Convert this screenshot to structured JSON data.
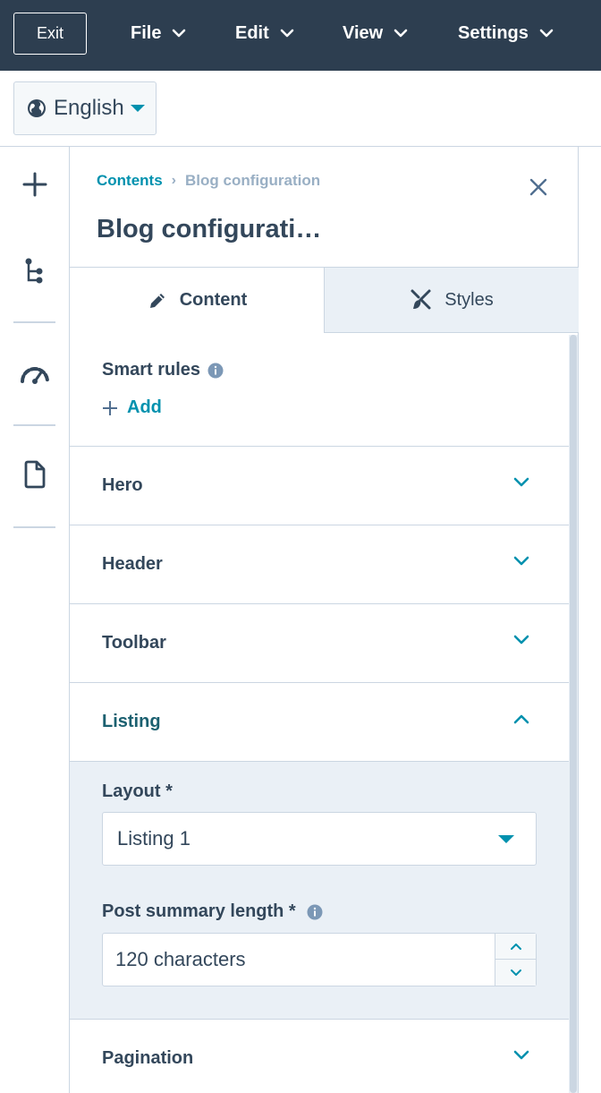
{
  "topbar": {
    "exit_label": "Exit",
    "menus": [
      {
        "label": "File"
      },
      {
        "label": "Edit"
      },
      {
        "label": "View"
      },
      {
        "label": "Settings"
      }
    ]
  },
  "language": {
    "selected": "English",
    "icon": "globe-icon"
  },
  "rail": {
    "icons": [
      "plus-icon",
      "tree-icon",
      "gauge-icon",
      "page-icon"
    ]
  },
  "panel": {
    "breadcrumb": {
      "parent": "Contents",
      "separator": "›",
      "current": "Blog configuration"
    },
    "title": "Blog configurati…",
    "tabs": [
      {
        "label": "Content",
        "icon": "pencil-icon",
        "active": true
      },
      {
        "label": "Styles",
        "icon": "brush-icon",
        "active": false
      }
    ],
    "smart_rules": {
      "label": "Smart rules",
      "add_label": "Add"
    },
    "sections": [
      {
        "label": "Hero",
        "open": false
      },
      {
        "label": "Header",
        "open": false
      },
      {
        "label": "Toolbar",
        "open": false
      },
      {
        "label": "Listing",
        "open": true
      },
      {
        "label": "Pagination",
        "open": false
      }
    ],
    "listing": {
      "layout_label": "Layout *",
      "layout_value": "Listing 1",
      "summary_label": "Post summary length *",
      "summary_value": "120 characters"
    }
  },
  "colors": {
    "topbar": "#2d3e50",
    "accent": "#0091ae",
    "text": "#33475b",
    "border": "#cbd6e2",
    "panel_bg": "#eaf0f6"
  }
}
